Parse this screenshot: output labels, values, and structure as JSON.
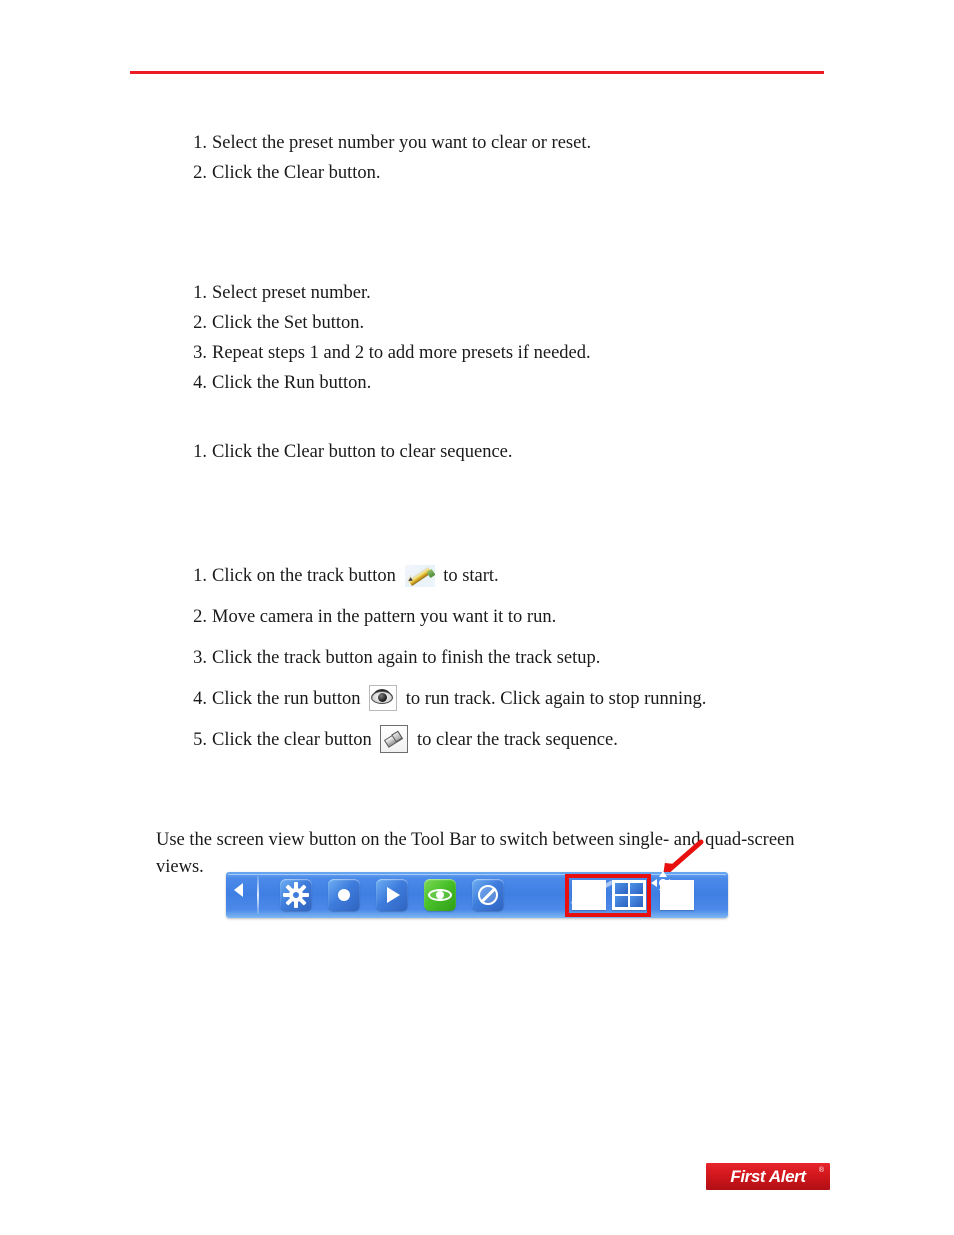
{
  "document": {
    "header_rule_color": "#ed1b24",
    "brand_red": "#e8100f"
  },
  "clear_preset": {
    "steps": [
      {
        "num": "1.",
        "text": "Select the preset number you want to clear or reset."
      },
      {
        "num": "2.",
        "text": "Click the Clear button."
      }
    ]
  },
  "preset_sequence": {
    "steps": [
      {
        "num": "1.",
        "text": "Select preset number."
      },
      {
        "num": "2.",
        "text": "Click the Set button."
      },
      {
        "num": "3.",
        "text": "Repeat steps 1 and 2 to add more presets if needed."
      },
      {
        "num": "4.",
        "text": "Click the Run button."
      }
    ]
  },
  "clear_sequence": {
    "steps": [
      {
        "num": "1.",
        "text": "Click the Clear button to clear sequence."
      }
    ]
  },
  "track": {
    "steps": [
      {
        "num": "1.",
        "text_before": "Click on the track button",
        "icon": "pencil-icon",
        "text_after": "to start."
      },
      {
        "num": "2.",
        "text_before": "Move camera in the pattern you want it to run.",
        "icon": "",
        "text_after": ""
      },
      {
        "num": "3.",
        "text_before": "Click the track button again to finish the track setup.",
        "icon": "",
        "text_after": ""
      },
      {
        "num": "4.",
        "text_before": "Click the run button",
        "icon": "eye-icon",
        "text_after": "to run track. Click again to stop running."
      },
      {
        "num": "5.",
        "text_before": "Click the clear button",
        "icon": "eraser-icon",
        "text_after": "to clear the track sequence."
      }
    ]
  },
  "screen_view": {
    "paragraph": "Use the screen view button on the Tool Bar to switch between single- and quad-screen views."
  },
  "toolbar": {
    "collapse_label": "collapse-arrow",
    "buttons": [
      {
        "name": "settings-button",
        "icon": "gear-icon",
        "color": "#3f7ddd"
      },
      {
        "name": "record-button",
        "icon": "record-dot-icon",
        "color": "#3f7ddd"
      },
      {
        "name": "play-button",
        "icon": "play-icon",
        "color": "#3f7ddd"
      },
      {
        "name": "preview-button",
        "icon": "eye-icon",
        "color": "#49c02a"
      },
      {
        "name": "privacy-mask-button",
        "icon": "circle-slash-icon",
        "color": "#3f7ddd"
      }
    ],
    "view_buttons": [
      {
        "name": "single-screen-view-button",
        "icon": "single-screen-icon"
      },
      {
        "name": "quad-screen-view-button",
        "icon": "quad-screen-icon"
      },
      {
        "name": "ptz-control-button",
        "icon": "ptz-direction-icon"
      }
    ],
    "highlight_color": "#e8100f"
  },
  "footer": {
    "logo_text": "First Alert",
    "logo_trademark": "®",
    "logo_color": "#d2171d"
  }
}
